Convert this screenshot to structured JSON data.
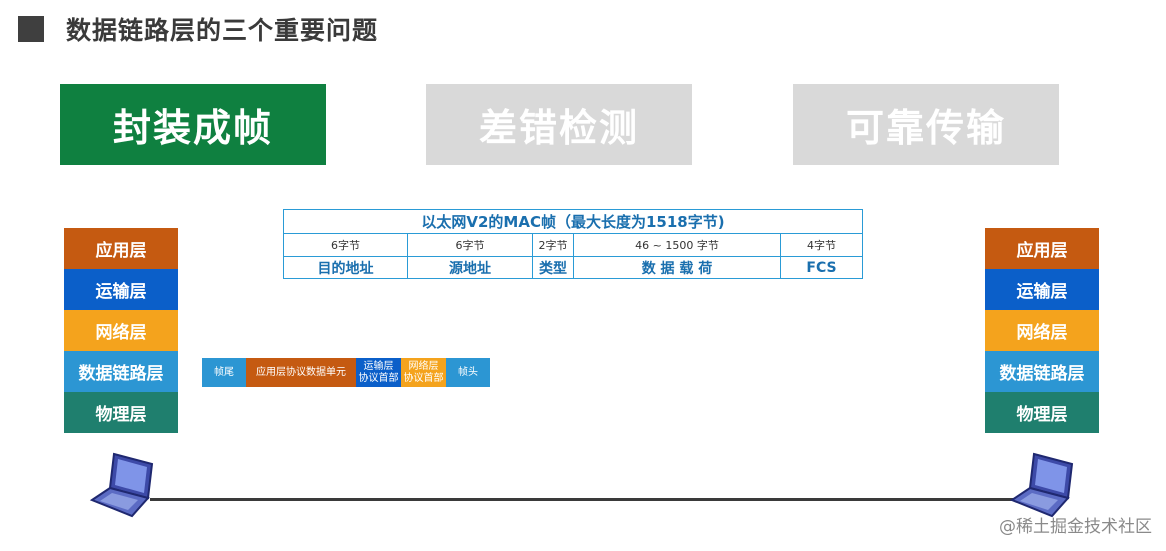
{
  "page": {
    "title": "数据链路层的三个重要问题"
  },
  "topics": [
    {
      "label": "封装成帧",
      "state": "active"
    },
    {
      "label": "差错检测",
      "state": "inactive"
    },
    {
      "label": "可靠传输",
      "state": "inactive"
    }
  ],
  "stack_left": {
    "layers": [
      {
        "label": "应用层",
        "color": "#c55a11"
      },
      {
        "label": "运输层",
        "color": "#0b5fc9"
      },
      {
        "label": "网络层",
        "color": "#f4a31d"
      },
      {
        "label": "数据链路层",
        "color": "#2c96d3"
      },
      {
        "label": "物理层",
        "color": "#1f7f6e"
      }
    ]
  },
  "stack_right": {
    "layers": [
      {
        "label": "应用层",
        "color": "#c55a11"
      },
      {
        "label": "运输层",
        "color": "#0b5fc9"
      },
      {
        "label": "网络层",
        "color": "#f4a31d"
      },
      {
        "label": "数据链路层",
        "color": "#2c96d3"
      },
      {
        "label": "物理层",
        "color": "#1f7f6e"
      }
    ]
  },
  "mac_frame": {
    "title": "以太网V2的MAC帧（最大长度为1518字节)",
    "sizes": [
      "6字节",
      "6字节",
      "2字节",
      "46 ~ 1500 字节",
      "4字节"
    ],
    "fields": [
      "目的地址",
      "源地址",
      "类型",
      "数 据 载 荷",
      "FCS"
    ]
  },
  "pdu": [
    {
      "line1": "帧尾",
      "line2": "",
      "color": "#2c96d3"
    },
    {
      "line1": "应用层协议数据单元",
      "line2": "",
      "color": "#c55a11"
    },
    {
      "line1": "运输层",
      "line2": "协议首部",
      "color": "#0b5fc9"
    },
    {
      "line1": "网络层",
      "line2": "协议首部",
      "color": "#f4a31d"
    },
    {
      "line1": "帧头",
      "line2": "",
      "color": "#2c96d3"
    }
  ],
  "icons": {
    "left_host": "laptop-icon",
    "right_host": "laptop-icon"
  },
  "watermark": "@稀土掘金技术社区"
}
